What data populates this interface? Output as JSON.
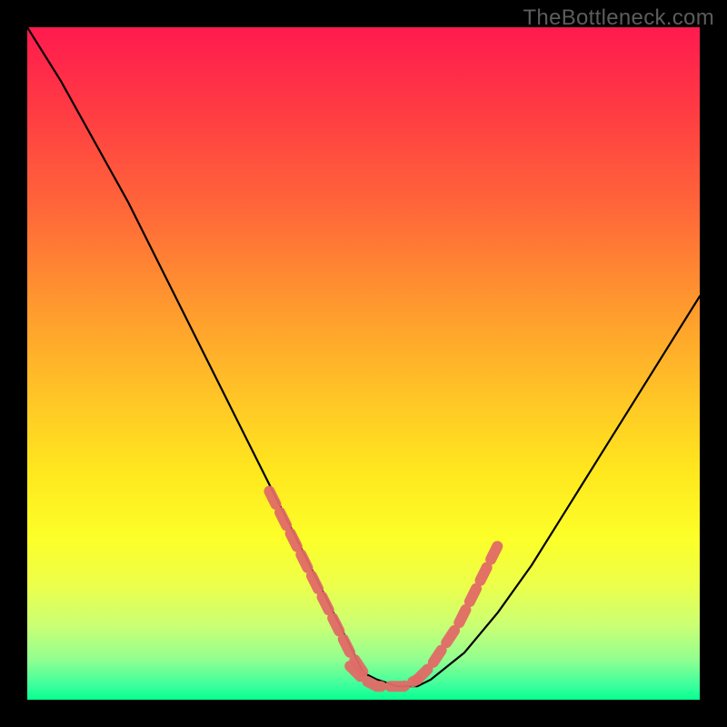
{
  "watermark": "TheBottleneck.com",
  "chart_data": {
    "type": "line",
    "title": "",
    "xlabel": "",
    "ylabel": "",
    "xlim": [
      0,
      100
    ],
    "ylim": [
      0,
      100
    ],
    "legend": false,
    "grid": false,
    "background": "rainbow-gradient-vertical",
    "series": [
      {
        "name": "bottleneck-curve",
        "x": [
          0,
          5,
          10,
          15,
          20,
          25,
          30,
          35,
          40,
          45,
          48,
          50,
          52,
          55,
          58,
          60,
          65,
          70,
          75,
          80,
          85,
          90,
          95,
          100
        ],
        "y": [
          100,
          92,
          83,
          74,
          64,
          54,
          44,
          34,
          24,
          14,
          8,
          4,
          3,
          2,
          2,
          3,
          7,
          13,
          20,
          28,
          36,
          44,
          52,
          60
        ],
        "note": "Main black V-shaped curve; left branch steeper, right branch shallower."
      },
      {
        "name": "highlight-left",
        "x": [
          36,
          38,
          40,
          42,
          44,
          46,
          48,
          50
        ],
        "y": [
          31,
          27,
          23,
          19,
          15,
          11,
          7,
          4
        ],
        "style": "thick-dashed-salmon",
        "note": "Thick salmon dashed overlay along left branch near bottom."
      },
      {
        "name": "highlight-bottom",
        "x": [
          48,
          50,
          52,
          54,
          56,
          58
        ],
        "y": [
          5,
          3,
          2,
          2,
          2,
          3
        ],
        "style": "thick-dashed-salmon",
        "note": "Thick salmon dashed overlay along the valley floor."
      },
      {
        "name": "highlight-right",
        "x": [
          58,
          60,
          62,
          64,
          66,
          68,
          70
        ],
        "y": [
          3,
          5,
          8,
          11,
          15,
          19,
          23
        ],
        "style": "thick-dashed-salmon",
        "note": "Thick salmon dashed overlay along right branch near bottom."
      }
    ],
    "colors": {
      "curve": "#000000",
      "highlight": "#e06a66",
      "gradient_top": "#ff1a4f",
      "gradient_bottom": "#06ff90"
    }
  }
}
